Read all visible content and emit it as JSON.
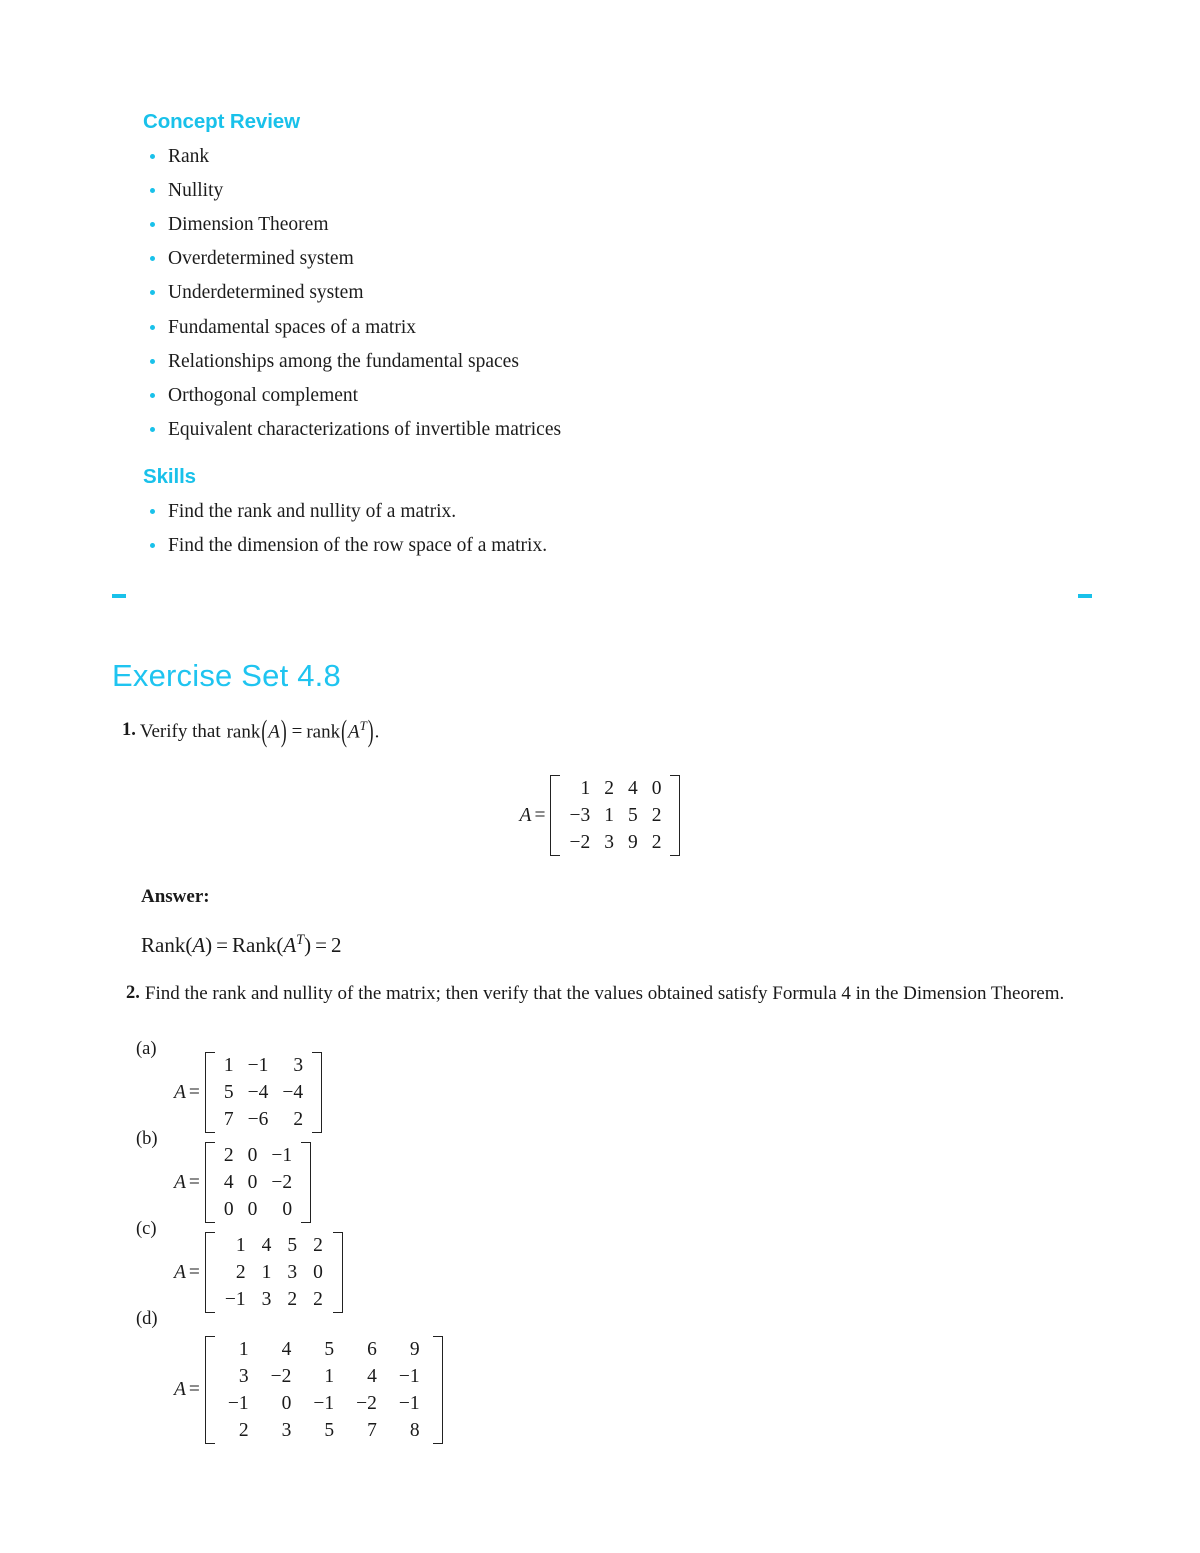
{
  "review": {
    "concept_heading": "Concept Review",
    "concept_items": [
      "Rank",
      "Nullity",
      "Dimension Theorem",
      "Overdetermined system",
      "Underdetermined system",
      "Fundamental spaces of a matrix",
      "Relationships among the fundamental spaces",
      "Orthogonal complement",
      "Equivalent characterizations of invertible matrices"
    ],
    "skills_heading": "Skills",
    "skills_items": [
      "Find the rank and nullity of a matrix.",
      "Find the dimension of the row space of a matrix."
    ]
  },
  "exercise": {
    "title": "Exercise Set 4.8"
  },
  "problem1": {
    "number": "1.",
    "text": "Verify that",
    "formula": {
      "lhs_fn": "rank",
      "lhs_arg": "A",
      "equals": "=",
      "rhs_fn": "rank",
      "rhs_arg": "A",
      "rhs_sup": "T",
      "period": "."
    },
    "matrix": {
      "label": "A",
      "equals": "=",
      "rows": [
        [
          "1",
          "2",
          "4",
          "0"
        ],
        [
          "−3",
          "1",
          "5",
          "2"
        ],
        [
          "−2",
          "3",
          "9",
          "2"
        ]
      ]
    },
    "answer": {
      "label": "Answer:",
      "text_parts": {
        "rank1": "Rank(",
        "a1": "A",
        "close1": ")",
        "eq1": "=",
        "rank2": "Rank(",
        "a2": "A",
        "sup2": "T",
        "close2": ")",
        "eq2": "=",
        "value": "2"
      }
    }
  },
  "problem2": {
    "number": "2.",
    "text": "Find the rank and nullity of the matrix; then verify that the values obtained satisfy Formula 4 in the Dimension Theorem.",
    "parts": [
      {
        "label": "(a)",
        "matrix_label": "A",
        "equals": "=",
        "rows": [
          [
            "1",
            "−1",
            "3"
          ],
          [
            "5",
            "−4",
            "−4"
          ],
          [
            "7",
            "−6",
            "2"
          ]
        ]
      },
      {
        "label": "(b)",
        "matrix_label": "A",
        "equals": "=",
        "rows": [
          [
            "2",
            "0",
            "−1"
          ],
          [
            "4",
            "0",
            "−2"
          ],
          [
            "0",
            "0",
            "0"
          ]
        ]
      },
      {
        "label": "(c)",
        "matrix_label": "A",
        "equals": "=",
        "rows": [
          [
            "1",
            "4",
            "5",
            "2"
          ],
          [
            "2",
            "1",
            "3",
            "0"
          ],
          [
            "−1",
            "3",
            "2",
            "2"
          ]
        ]
      },
      {
        "label": "(d)",
        "matrix_label": "A",
        "equals": "=",
        "rows": [
          [
            "1",
            "4",
            "5",
            "6",
            "9"
          ],
          [
            "3",
            "−2",
            "1",
            "4",
            "−1"
          ],
          [
            "−1",
            "0",
            "−1",
            "−2",
            "−1"
          ],
          [
            "2",
            "3",
            "5",
            "7",
            "8"
          ]
        ]
      }
    ]
  },
  "colors": {
    "heading_cyan": "#19c1ea",
    "title_cyan": "#1fc4f0",
    "body_text": "#1c1c1c"
  }
}
